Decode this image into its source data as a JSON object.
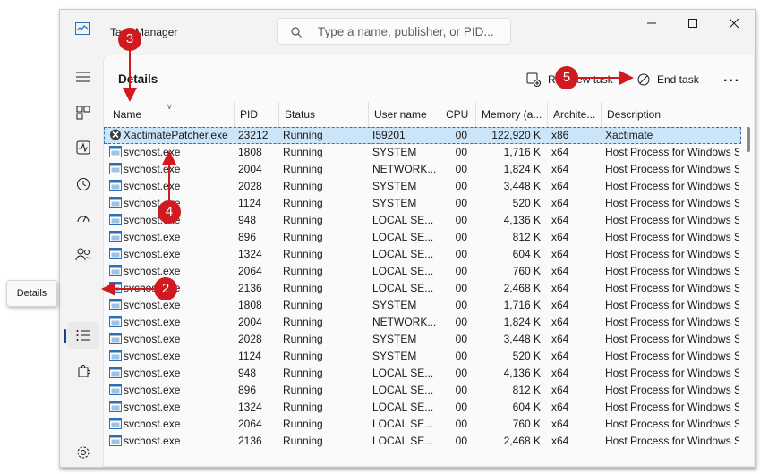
{
  "window": {
    "title": "Task Manager",
    "search_placeholder": "Type a name, publisher, or PID..."
  },
  "page": {
    "title": "Details",
    "tooltip": "Details"
  },
  "toolbar": {
    "run_task_label": "Run new task",
    "end_task_label": "End task"
  },
  "columns": [
    "Name",
    "PID",
    "Status",
    "User name",
    "CPU",
    "Memory (a...",
    "Archite...",
    "Description"
  ],
  "rows": [
    {
      "name": "XactimatePatcher.exe",
      "pid": "23212",
      "status": "Running",
      "user": "I59201",
      "cpu": "00",
      "mem": "122,920 K",
      "arch": "x86",
      "desc": "Xactimate",
      "selected": true
    },
    {
      "name": "svchost.exe",
      "pid": "1808",
      "status": "Running",
      "user": "SYSTEM",
      "cpu": "00",
      "mem": "1,716 K",
      "arch": "x64",
      "desc": "Host Process for Windows S"
    },
    {
      "name": "svchost.exe",
      "pid": "2004",
      "status": "Running",
      "user": "NETWORK...",
      "cpu": "00",
      "mem": "1,824 K",
      "arch": "x64",
      "desc": "Host Process for Windows S"
    },
    {
      "name": "svchost.exe",
      "pid": "2028",
      "status": "Running",
      "user": "SYSTEM",
      "cpu": "00",
      "mem": "3,448 K",
      "arch": "x64",
      "desc": "Host Process for Windows S"
    },
    {
      "name": "svchost.exe",
      "pid": "1124",
      "status": "Running",
      "user": "SYSTEM",
      "cpu": "00",
      "mem": "520 K",
      "arch": "x64",
      "desc": "Host Process for Windows S"
    },
    {
      "name": "svchost.exe",
      "pid": "948",
      "status": "Running",
      "user": "LOCAL SE...",
      "cpu": "00",
      "mem": "4,136 K",
      "arch": "x64",
      "desc": "Host Process for Windows S"
    },
    {
      "name": "svchost.exe",
      "pid": "896",
      "status": "Running",
      "user": "LOCAL SE...",
      "cpu": "00",
      "mem": "812 K",
      "arch": "x64",
      "desc": "Host Process for Windows S"
    },
    {
      "name": "svchost.exe",
      "pid": "1324",
      "status": "Running",
      "user": "LOCAL SE...",
      "cpu": "00",
      "mem": "604 K",
      "arch": "x64",
      "desc": "Host Process for Windows S"
    },
    {
      "name": "svchost.exe",
      "pid": "2064",
      "status": "Running",
      "user": "LOCAL SE...",
      "cpu": "00",
      "mem": "760 K",
      "arch": "x64",
      "desc": "Host Process for Windows S"
    },
    {
      "name": "svchost.exe",
      "pid": "2136",
      "status": "Running",
      "user": "LOCAL SE...",
      "cpu": "00",
      "mem": "2,468 K",
      "arch": "x64",
      "desc": "Host Process for Windows S"
    },
    {
      "name": "svchost.exe",
      "pid": "1808",
      "status": "Running",
      "user": "SYSTEM",
      "cpu": "00",
      "mem": "1,716 K",
      "arch": "x64",
      "desc": "Host Process for Windows S"
    },
    {
      "name": "svchost.exe",
      "pid": "2004",
      "status": "Running",
      "user": "NETWORK...",
      "cpu": "00",
      "mem": "1,824 K",
      "arch": "x64",
      "desc": "Host Process for Windows S"
    },
    {
      "name": "svchost.exe",
      "pid": "2028",
      "status": "Running",
      "user": "SYSTEM",
      "cpu": "00",
      "mem": "3,448 K",
      "arch": "x64",
      "desc": "Host Process for Windows S"
    },
    {
      "name": "svchost.exe",
      "pid": "1124",
      "status": "Running",
      "user": "SYSTEM",
      "cpu": "00",
      "mem": "520 K",
      "arch": "x64",
      "desc": "Host Process for Windows S"
    },
    {
      "name": "svchost.exe",
      "pid": "948",
      "status": "Running",
      "user": "LOCAL SE...",
      "cpu": "00",
      "mem": "4,136 K",
      "arch": "x64",
      "desc": "Host Process for Windows S"
    },
    {
      "name": "svchost.exe",
      "pid": "896",
      "status": "Running",
      "user": "LOCAL SE...",
      "cpu": "00",
      "mem": "812 K",
      "arch": "x64",
      "desc": "Host Process for Windows S"
    },
    {
      "name": "svchost.exe",
      "pid": "1324",
      "status": "Running",
      "user": "LOCAL SE...",
      "cpu": "00",
      "mem": "604 K",
      "arch": "x64",
      "desc": "Host Process for Windows S"
    },
    {
      "name": "svchost.exe",
      "pid": "2064",
      "status": "Running",
      "user": "LOCAL SE...",
      "cpu": "00",
      "mem": "760 K",
      "arch": "x64",
      "desc": "Host Process for Windows S"
    },
    {
      "name": "svchost.exe",
      "pid": "2136",
      "status": "Running",
      "user": "LOCAL SE...",
      "cpu": "00",
      "mem": "2,468 K",
      "arch": "x64",
      "desc": "Host Process for Windows S"
    }
  ],
  "callouts": [
    "2",
    "3",
    "4",
    "5"
  ],
  "colors": {
    "callout": "#d11a1f",
    "selection": "#cce4f7",
    "accent": "#1f3a93"
  }
}
